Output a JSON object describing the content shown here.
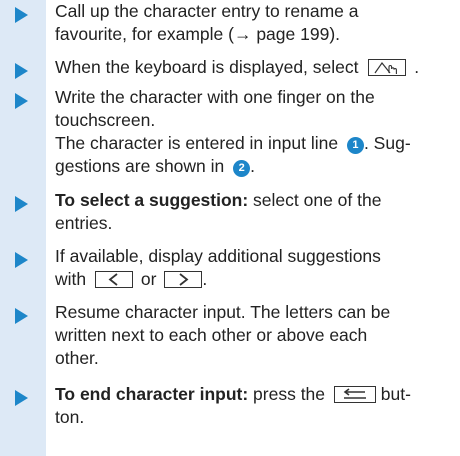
{
  "steps": [
    {
      "line1": "Call up the character entry to rename a",
      "line2": "favourite, for example (→ page 199)."
    },
    {
      "before": "When the keyboard is displayed, select",
      "after": ".",
      "key_icon": "handwriting-icon"
    },
    {
      "line1": "Write the character with one finger on the",
      "line2": "touchscreen.",
      "line3_before": "The character is entered in input line",
      "line3_badge": "1",
      "line3_after": ". Sug-",
      "line4_before": "gestions are shown in",
      "line4_badge": "2",
      "line4_after": "."
    },
    {
      "bold": "To select a suggestion:",
      "line1_rest": " select one of the",
      "line2": "entries."
    },
    {
      "line1": "If available, display additional suggestions",
      "line2_before": "with",
      "line2_mid": "or",
      "line2_after": ".",
      "prev_icon": "chevron-left-icon",
      "next_icon": "chevron-right-icon"
    },
    {
      "line1": "Resume character input. The letters can be",
      "line2": "written next to each other or above each",
      "line3": "other."
    },
    {
      "bold": "To end character input:",
      "line1_rest": " press the",
      "line1_after": " but-",
      "line2": "ton.",
      "key_icon": "back-arrow-icon"
    }
  ]
}
